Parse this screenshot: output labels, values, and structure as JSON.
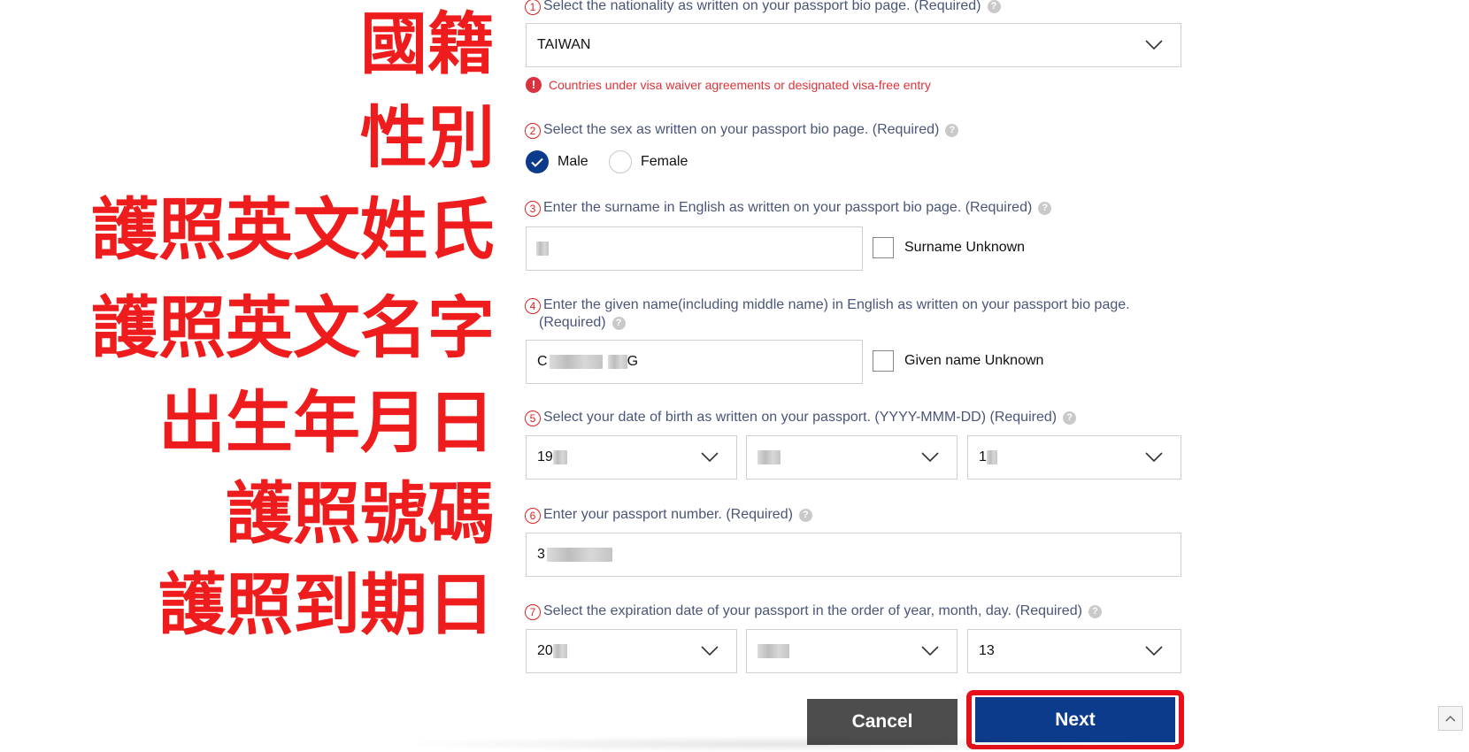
{
  "annotations": {
    "nationality": "國籍",
    "sex": "性別",
    "surname": "護照英文姓氏",
    "given_name": "護照英文名字",
    "dob": "出生年月日",
    "passport_no": "護照號碼",
    "expiry": "護照到期日"
  },
  "questions": {
    "q1": {
      "num": "1",
      "text": "Select the nationality as written on your passport bio page. (Required)"
    },
    "q2": {
      "num": "2",
      "text": "Select the sex as written on your passport bio page. (Required)"
    },
    "q3": {
      "num": "3",
      "text": "Enter the surname in English as written on your passport bio page. (Required)"
    },
    "q4": {
      "num": "4",
      "text_line1": "Enter the given name(including middle name) in English as written on your passport bio page.",
      "text_line2": "(Required)"
    },
    "q5": {
      "num": "5",
      "text": "Select your date of birth as written on your passport. (YYYY-MMM-DD) (Required)"
    },
    "q6": {
      "num": "6",
      "text": "Enter your passport number. (Required)"
    },
    "q7": {
      "num": "7",
      "text": "Select the expiration date of your passport in the order of year, month, day. (Required)"
    }
  },
  "help_glyph": "?",
  "nationality": {
    "value": "TAIWAN"
  },
  "nationality_notice": {
    "icon": "!",
    "text": "Countries under visa waiver agreements or designated visa-free entry"
  },
  "sex": {
    "options": [
      {
        "label": "Male",
        "selected": true
      },
      {
        "label": "Female",
        "selected": false
      }
    ]
  },
  "surname": {
    "value": "",
    "unknown_label": "Surname Unknown"
  },
  "given_name": {
    "value_start": "C",
    "value_end": "G",
    "unknown_label": "Given name Unknown"
  },
  "dob": {
    "year": "19",
    "month": "",
    "day": "1"
  },
  "passport_number": {
    "value": "3"
  },
  "expiry": {
    "year": "20",
    "month": "",
    "day": "13"
  },
  "buttons": {
    "cancel": "Cancel",
    "next": "Next"
  },
  "colors": {
    "annotation": "#ee1c1c",
    "primary": "#0d3b8c",
    "cancel": "#4d4d4d",
    "error": "#e0323a",
    "highlight": "#e8101a"
  },
  "icons": {
    "chevron": "chevron-down-icon",
    "check": "check-icon",
    "scroll_top": "chevron-up-icon"
  }
}
